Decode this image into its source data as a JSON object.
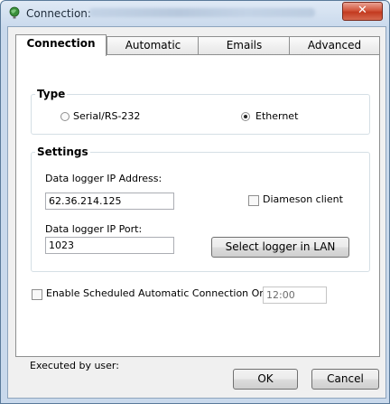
{
  "window": {
    "title": "Connection:"
  },
  "tabs": [
    {
      "label": "Connection"
    },
    {
      "label": "Automatic"
    },
    {
      "label": "Emails"
    },
    {
      "label": "Advanced"
    }
  ],
  "type_group": {
    "legend": "Type",
    "options": [
      {
        "label": "Serial/RS-232",
        "selected": false
      },
      {
        "label": "Ethernet",
        "selected": true
      }
    ]
  },
  "settings": {
    "legend": "Settings",
    "ip_label": "Data logger IP Address:",
    "ip_value": "62.36.214.125",
    "port_label": "Data logger IP Port:",
    "port_value": "1023",
    "diameson_label": "Diameson client",
    "diameson_checked": false,
    "select_logger_label": "Select logger in LAN"
  },
  "schedule": {
    "label": "Enable Scheduled Automatic Connection On:",
    "checked": false,
    "time_value": "12:00"
  },
  "executed_label": "Executed by user:",
  "buttons": {
    "ok": "OK",
    "cancel": "Cancel",
    "close": "✕"
  }
}
